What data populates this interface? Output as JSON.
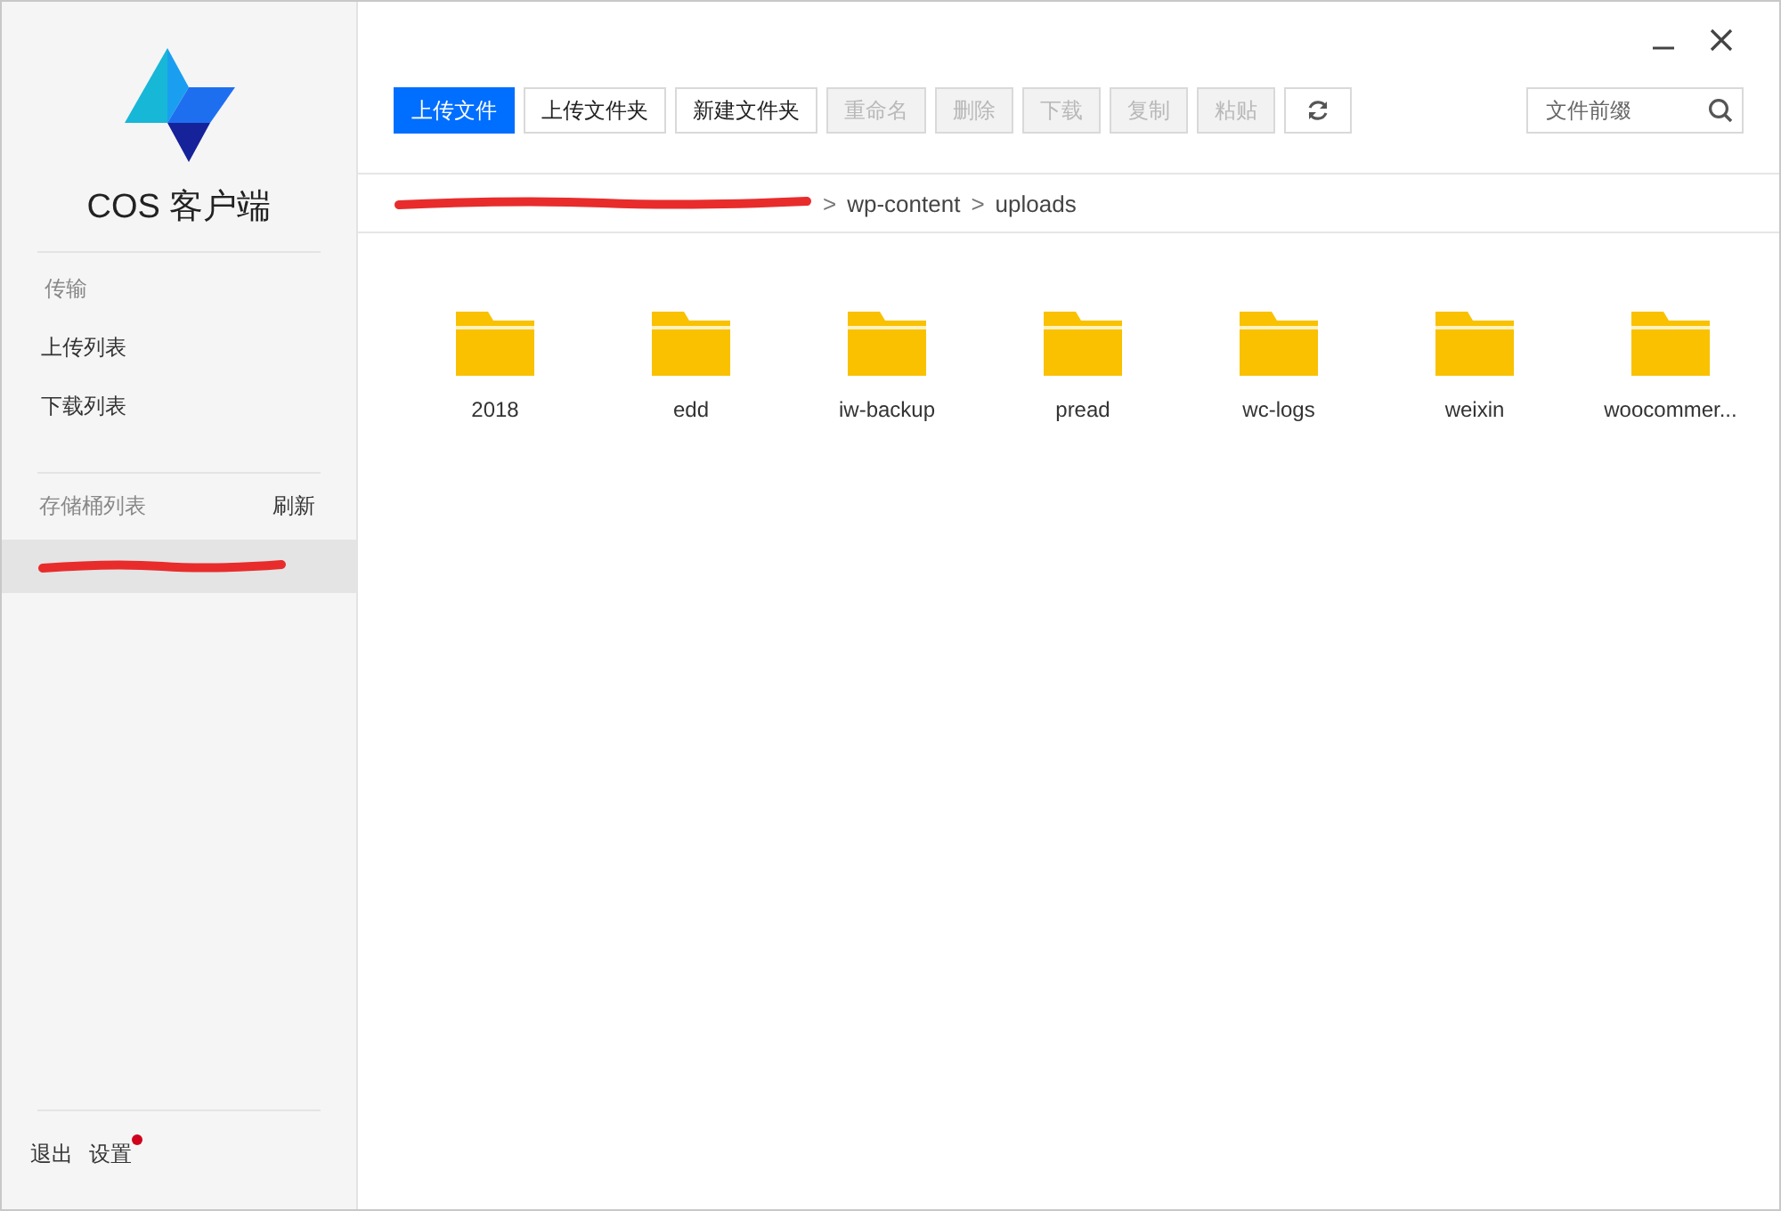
{
  "app": {
    "name": "COS 客户端"
  },
  "sidebar": {
    "transfer_heading": "传输",
    "transfer_items": [
      {
        "label": "上传列表",
        "selected": false
      },
      {
        "label": "下载列表",
        "selected": false
      }
    ],
    "buckets_heading": "存储桶列表",
    "refresh": "刷新",
    "buckets": [
      {
        "redacted": true,
        "selected": true
      }
    ],
    "footer": {
      "logout": "退出",
      "settings": "设置",
      "settings_badge": true
    }
  },
  "toolbar": {
    "buttons": [
      {
        "label": "上传文件",
        "kind": "primary",
        "disabled": false
      },
      {
        "label": "上传文件夹",
        "kind": "normal",
        "disabled": false
      },
      {
        "label": "新建文件夹",
        "kind": "normal",
        "disabled": false
      },
      {
        "label": "重命名",
        "kind": "normal",
        "disabled": true
      },
      {
        "label": "删除",
        "kind": "normal",
        "disabled": true
      },
      {
        "label": "下载",
        "kind": "normal",
        "disabled": true
      },
      {
        "label": "复制",
        "kind": "normal",
        "disabled": true
      },
      {
        "label": "粘贴",
        "kind": "normal",
        "disabled": true
      },
      {
        "kind": "refresh",
        "disabled": false
      }
    ],
    "search": {
      "placeholder": "文件前缀"
    }
  },
  "breadcrumb": [
    {
      "redacted": true
    },
    {
      "separator": ">",
      "label": "wp-content"
    },
    {
      "separator": ">",
      "label": "uploads"
    }
  ],
  "folders": [
    {
      "name": "2018"
    },
    {
      "name": "edd"
    },
    {
      "name": "iw-backup"
    },
    {
      "name": "pread"
    },
    {
      "name": "wc-logs"
    },
    {
      "name": "weixin"
    },
    {
      "name": "woocommer..."
    }
  ]
}
